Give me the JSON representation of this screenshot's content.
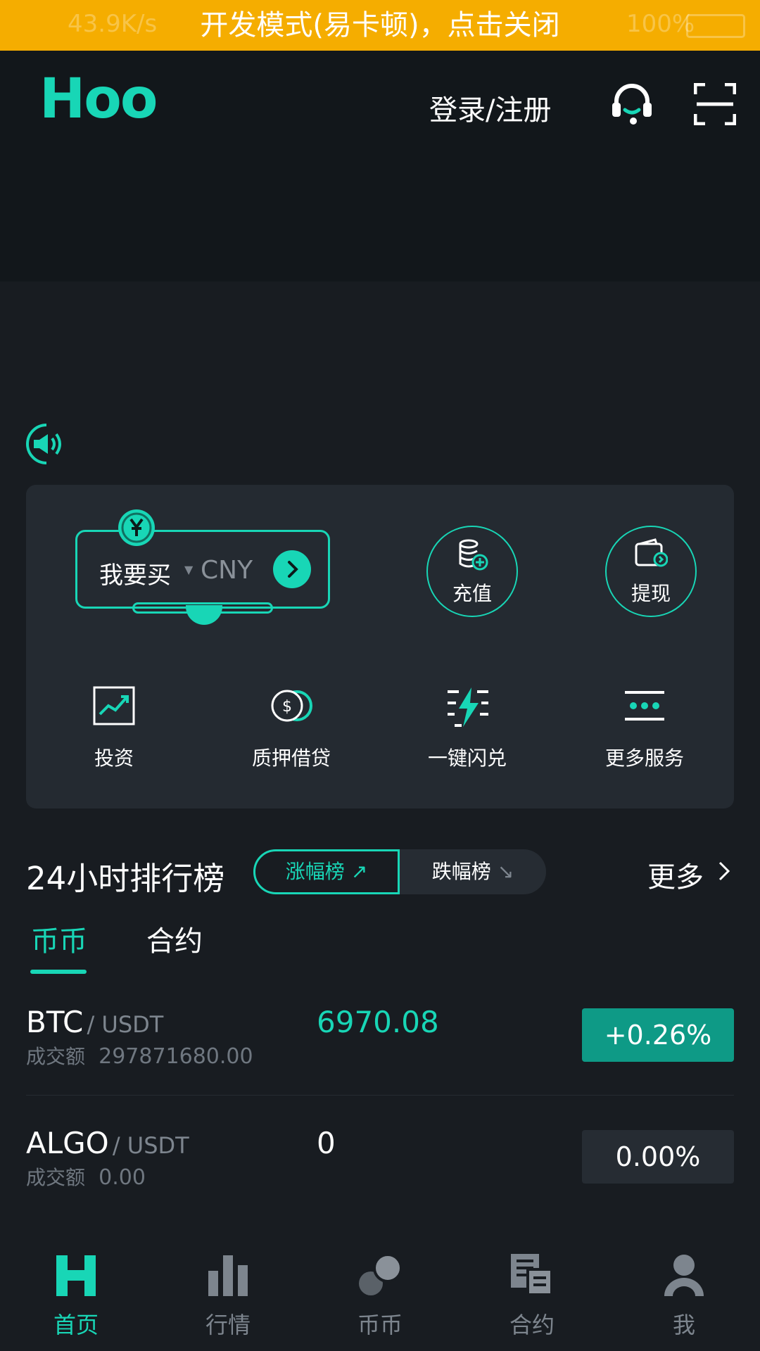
{
  "status_bar": {
    "speed": "43.9K/s",
    "battery": "100%"
  },
  "dev_banner": {
    "text": "开发模式(易卡顿)，点击关闭"
  },
  "header": {
    "logo": "Hoo",
    "login_label": "登录/注册"
  },
  "quick_actions": {
    "buy": {
      "label": "我要买",
      "currency": "CNY"
    },
    "deposit_label": "充值",
    "withdraw_label": "提现"
  },
  "services": [
    {
      "label": "投资",
      "icon": "chart-up-icon"
    },
    {
      "label": "质押借贷",
      "icon": "coin-dollar-icon"
    },
    {
      "label": "一键闪兑",
      "icon": "lightning-icon"
    },
    {
      "label": "更多服务",
      "icon": "more-dots-icon"
    }
  ],
  "ranking": {
    "title": "24小时排行榜",
    "gainers_label": "涨幅榜",
    "losers_label": "跌幅榜",
    "more_label": "更多",
    "tabs": [
      "币币",
      "合约"
    ],
    "rows": [
      {
        "base": "BTC",
        "quote": "USDT",
        "volume_label": "成交额",
        "volume": "297871680.00",
        "price": "6970.08",
        "change": "+0.26%"
      },
      {
        "base": "ALGO",
        "quote": "USDT",
        "volume_label": "成交额",
        "volume": "0.00",
        "price": "0",
        "change": "0.00%"
      }
    ]
  },
  "bottom_nav": [
    {
      "label": "首页",
      "active": true
    },
    {
      "label": "行情",
      "active": false
    },
    {
      "label": "币币",
      "active": false
    },
    {
      "label": "合约",
      "active": false
    },
    {
      "label": "我",
      "active": false
    }
  ],
  "colors": {
    "accent": "#18d6b6",
    "up": "#0e9a86",
    "neutral": "#262c33",
    "banner": "#f5ad00",
    "background": "#181c21"
  }
}
